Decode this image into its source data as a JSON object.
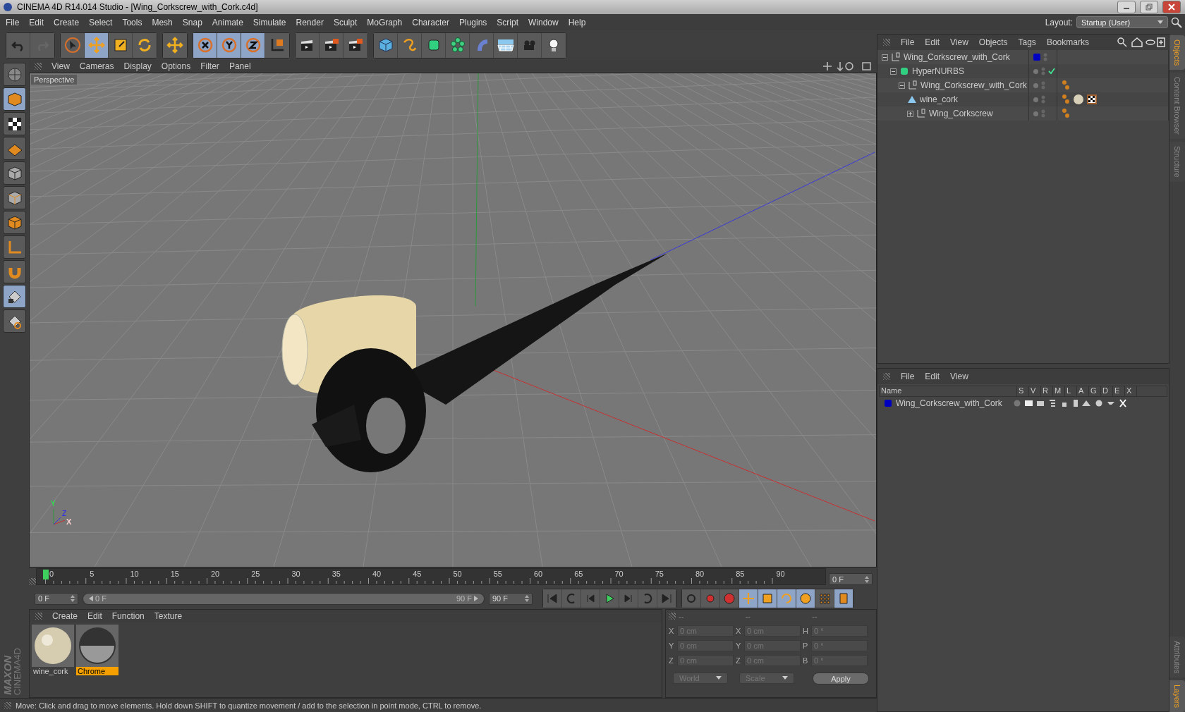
{
  "window": {
    "title": "CINEMA 4D R14.014 Studio - [Wing_Corkscrew_with_Cork.c4d]"
  },
  "menu": [
    "File",
    "Edit",
    "Create",
    "Select",
    "Tools",
    "Mesh",
    "Snap",
    "Animate",
    "Simulate",
    "Render",
    "Sculpt",
    "MoGraph",
    "Character",
    "Plugins",
    "Script",
    "Window",
    "Help"
  ],
  "layout": {
    "label": "Layout:",
    "value": "Startup (User)"
  },
  "toolbar": [
    {
      "tools": [
        {
          "kind": "undo",
          "selected": false
        },
        {
          "kind": "redo",
          "selected": false
        }
      ]
    },
    {
      "tools": [
        {
          "kind": "select",
          "selected": false
        },
        {
          "kind": "move",
          "selected": true
        },
        {
          "kind": "scale",
          "selected": false
        },
        {
          "kind": "rotate",
          "selected": false
        }
      ]
    },
    {
      "tools": [
        {
          "kind": "add",
          "selected": false
        }
      ]
    },
    {
      "tools": [
        {
          "kind": "x",
          "selected": true
        },
        {
          "kind": "y",
          "selected": true
        },
        {
          "kind": "z",
          "selected": true
        },
        {
          "kind": "coords",
          "selected": false
        }
      ]
    },
    {
      "tools": [
        {
          "kind": "render",
          "selected": false
        },
        {
          "kind": "render-viewer",
          "selected": false
        },
        {
          "kind": "render-settings",
          "selected": false
        }
      ]
    },
    {
      "tools": [
        {
          "kind": "cube",
          "selected": false
        },
        {
          "kind": "spline",
          "selected": false
        },
        {
          "kind": "nurbs",
          "selected": false
        },
        {
          "kind": "cloner",
          "selected": false
        },
        {
          "kind": "deformer",
          "selected": false
        },
        {
          "kind": "floor",
          "selected": false
        },
        {
          "kind": "camera",
          "selected": false
        },
        {
          "kind": "light",
          "selected": false
        }
      ]
    }
  ],
  "left_tools": [
    {
      "kind": "editable",
      "selected": false
    },
    {
      "kind": "model",
      "selected": true
    },
    {
      "kind": "texture",
      "selected": false
    },
    {
      "kind": "workplane",
      "selected": false
    },
    {
      "kind": "points",
      "selected": false
    },
    {
      "kind": "edges",
      "selected": false
    },
    {
      "kind": "polygons",
      "selected": false
    },
    {
      "kind": "axis",
      "selected": false
    },
    {
      "kind": "magnet",
      "selected": false
    },
    {
      "kind": "lock",
      "selected": true
    },
    {
      "kind": "snap",
      "selected": false
    }
  ],
  "logo": [
    "MAXON",
    "CINEMA4D"
  ],
  "viewport": {
    "menu": [
      "View",
      "Cameras",
      "Display",
      "Options",
      "Filter",
      "Panel"
    ],
    "label": "Perspective",
    "gizmo": [
      "Y",
      "Z",
      "X"
    ]
  },
  "timeline": {
    "ticks": [
      "0",
      "5",
      "10",
      "15",
      "20",
      "25",
      "30",
      "35",
      "40",
      "45",
      "50",
      "55",
      "60",
      "65",
      "70",
      "75",
      "80",
      "85",
      "90"
    ],
    "playhead": {
      "level": 0
    },
    "frame": "0 F",
    "start": "0 F",
    "range_start": "0 F",
    "range_end": "90 F",
    "range": {
      "level": 1
    },
    "end": "90 F"
  },
  "playback": [
    {
      "kind": "first"
    },
    {
      "kind": "prev-key"
    },
    {
      "kind": "prev"
    },
    {
      "kind": "play"
    },
    {
      "kind": "next"
    },
    {
      "kind": "next-key"
    },
    {
      "kind": "last"
    }
  ],
  "record": [
    {
      "kind": "keys",
      "selected": false
    },
    {
      "kind": "record",
      "selected": false
    },
    {
      "kind": "help",
      "selected": false
    },
    {
      "kind": "move",
      "selected": true
    },
    {
      "kind": "scale",
      "selected": true
    },
    {
      "kind": "rotate",
      "selected": true
    },
    {
      "kind": "param",
      "selected": true
    },
    {
      "kind": "points",
      "selected": false
    },
    {
      "kind": "film",
      "selected": true
    }
  ],
  "materials": {
    "menu": [
      "Create",
      "Edit",
      "Function",
      "Texture"
    ],
    "items": [
      {
        "name": "wine_cork",
        "kind": "cork",
        "selected": false
      },
      {
        "name": "Chrome",
        "kind": "chrome",
        "selected": true
      }
    ]
  },
  "coordinates": {
    "disabled": true,
    "headers": [
      "--",
      "--",
      "--"
    ],
    "rows": [
      {
        "cells": [
          {
            "label": "X",
            "value": "0 cm"
          },
          {
            "label": "X",
            "value": "0 cm"
          },
          {
            "label": "H",
            "value": "0 °"
          }
        ]
      },
      {
        "cells": [
          {
            "label": "Y",
            "value": "0 cm"
          },
          {
            "label": "Y",
            "value": "0 cm"
          },
          {
            "label": "P",
            "value": "0 °"
          }
        ]
      },
      {
        "cells": [
          {
            "label": "Z",
            "value": "0 cm"
          },
          {
            "label": "Z",
            "value": "0 cm"
          },
          {
            "label": "B",
            "value": "0 °"
          }
        ]
      }
    ],
    "dropdowns": [
      "World",
      "Scale"
    ],
    "apply": "Apply"
  },
  "status_bar": "Move: Click and drag to move elements. Hold down SHIFT to quantize movement / add to the selection in point mode, CTRL to remove.",
  "objects": {
    "menu": [
      "File",
      "Edit",
      "View",
      "Objects",
      "Tags",
      "Bookmarks"
    ],
    "tree": [
      {
        "name": "Wing_Corkscrew_with_Cork",
        "kind": "null",
        "expanded": true,
        "color": "#0000c0",
        "children": [
          {
            "name": "HyperNURBS",
            "kind": "nurbs",
            "expanded": true,
            "enabled": true,
            "children": [
              {
                "name": "Wing_Corkscrew_with_Cork",
                "kind": "null",
                "expanded": true,
                "phong_tag": true,
                "children": [
                  {
                    "name": "wine_cork",
                    "kind": "polygon",
                    "phong_tag": true,
                    "material_tag": true,
                    "texture_tag": true
                  },
                  {
                    "name": "Wing_Corkscrew",
                    "kind": "null",
                    "expanded": false,
                    "phong_tag": true
                  }
                ]
              }
            ]
          }
        ]
      }
    ]
  },
  "layers": {
    "menu": [
      "File",
      "Edit",
      "View"
    ],
    "columns": [
      "Name",
      "S",
      "V",
      "R",
      "M",
      "L",
      "A",
      "G",
      "D",
      "E",
      "X"
    ],
    "rows": [
      {
        "name": "Wing_Corkscrew_with_Cork",
        "color": "#0000c0"
      }
    ]
  },
  "side_tabs": [
    {
      "label": "Objects",
      "selected": true
    },
    {
      "label": "Content Browser",
      "selected": false
    },
    {
      "label": "Structure",
      "selected": false
    },
    {
      "label": "Attributes",
      "selected": false
    },
    {
      "label": "Layers",
      "selected": true
    }
  ]
}
